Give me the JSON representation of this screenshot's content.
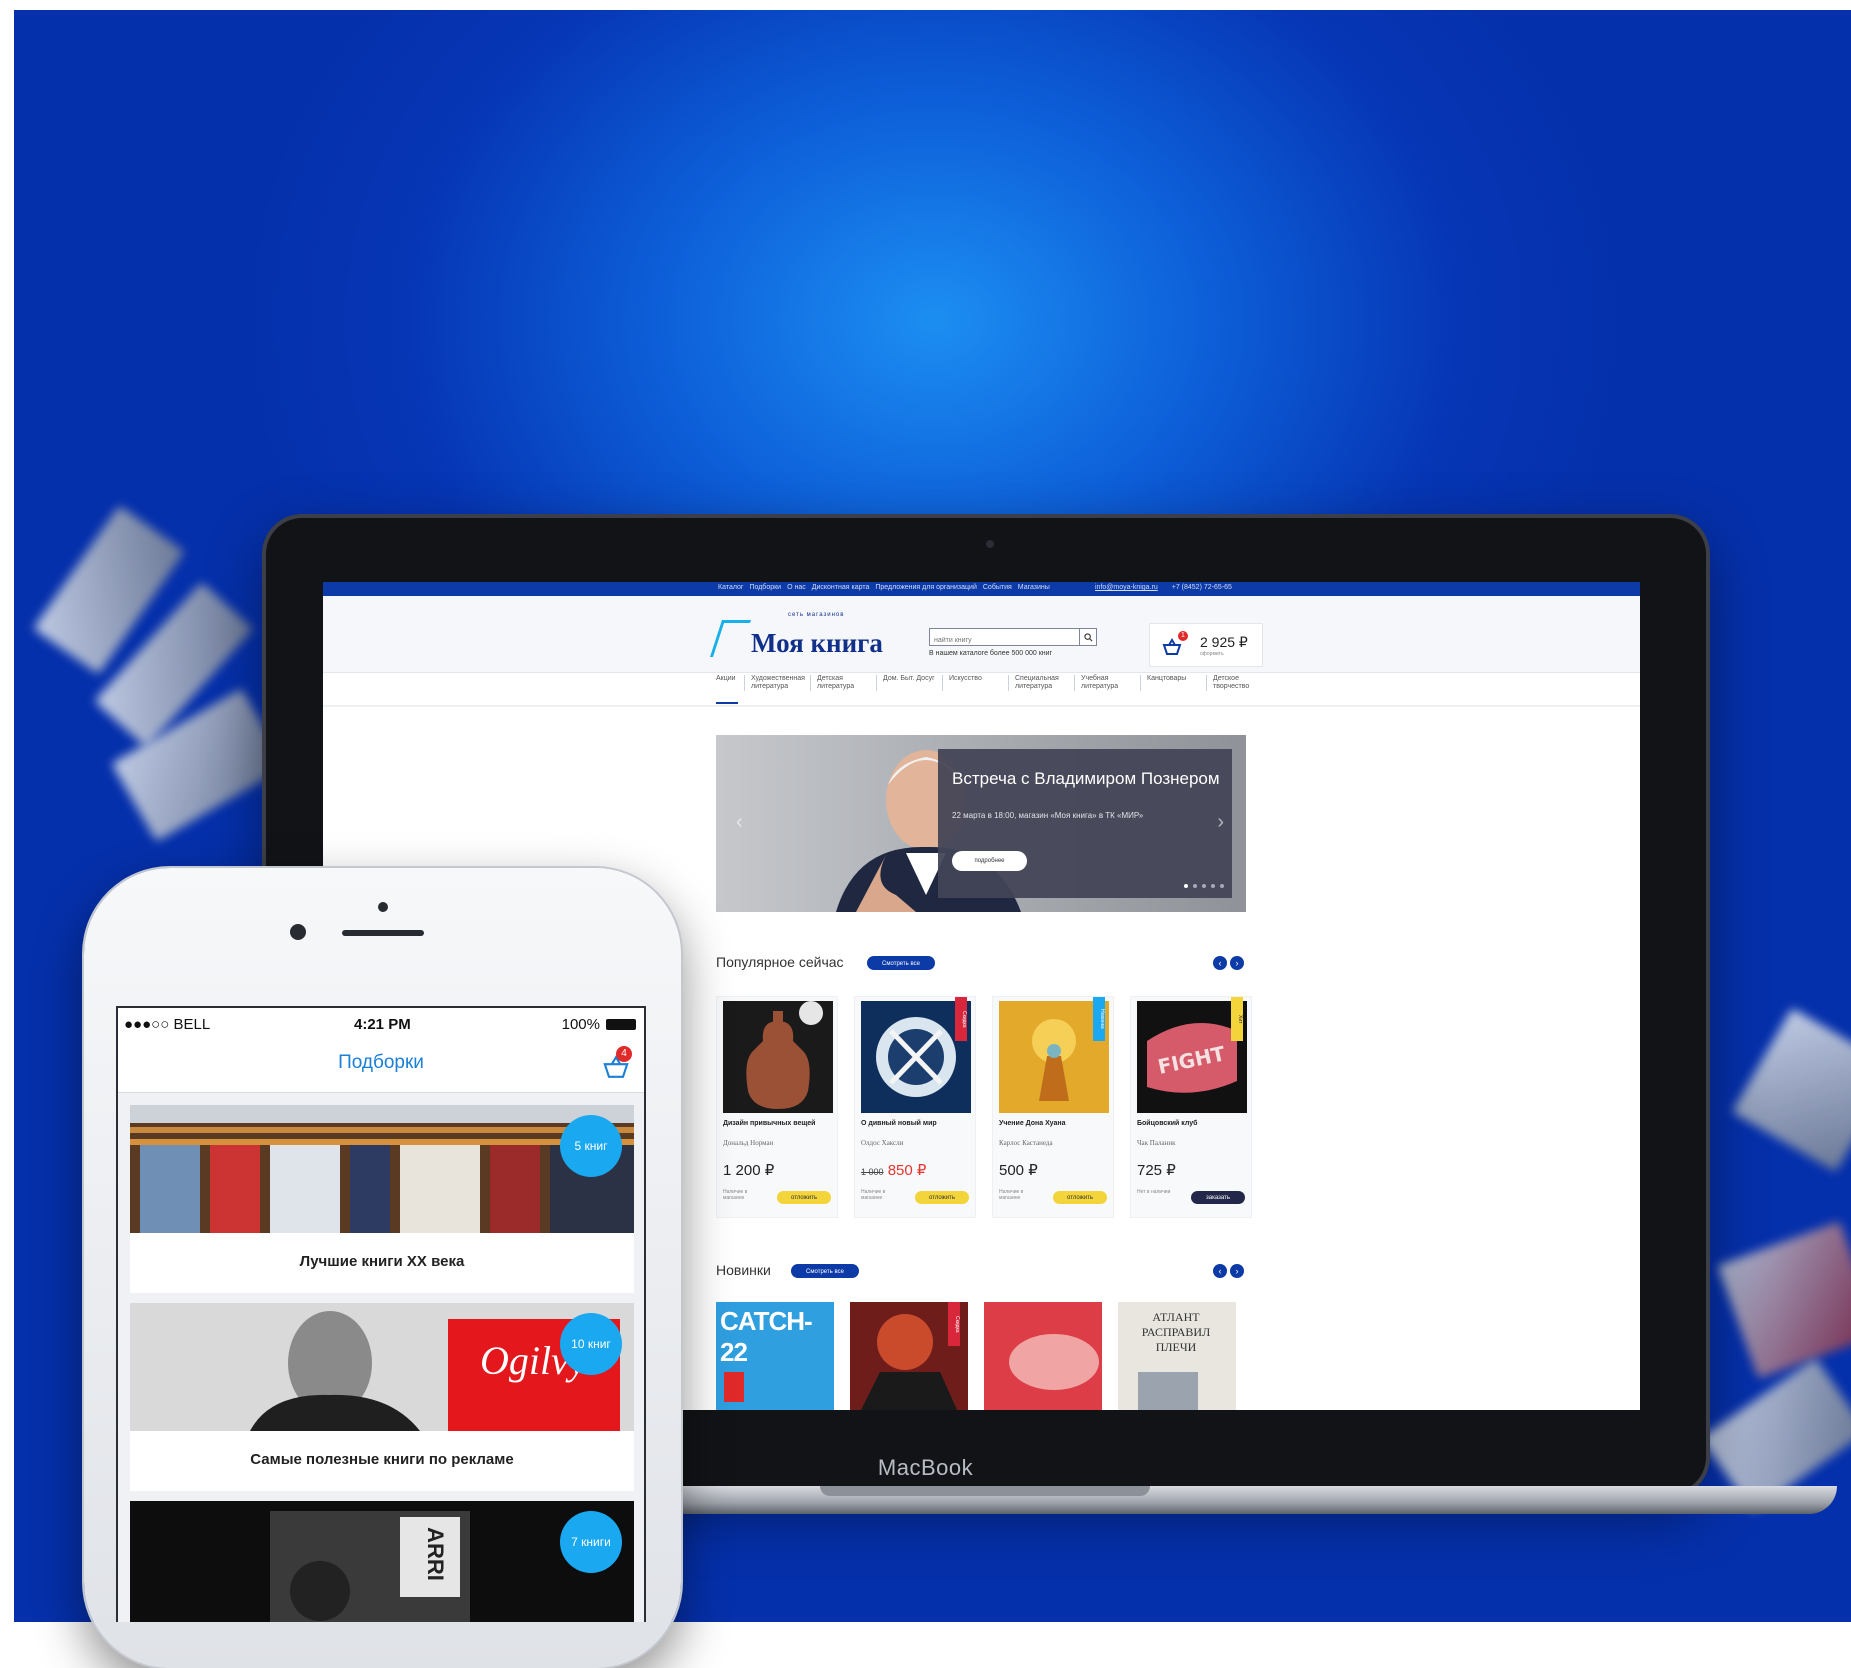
{
  "colors": {
    "brand_blue": "#0c3aa6",
    "accent_cyan": "#1aa9f0",
    "price_red": "#e4352f",
    "button_yellow": "#f3d43a",
    "background_blue": "#0636b5"
  },
  "laptop": {
    "brand": "MacBook"
  },
  "site": {
    "topnav": [
      "Каталог",
      "Подборки",
      "О нас",
      "Дисконтная карта",
      "Предложения для организаций",
      "События",
      "Магазины"
    ],
    "email": "info@moya-kniga.ru",
    "phone": "+7 (8452) 72-65-65",
    "logo_text": "Моя книга",
    "logo_subtitle": "сеть магазинов",
    "search": {
      "placeholder": "найти книгу",
      "note": "В нашем каталоге более 500 000 книг"
    },
    "cart": {
      "price": "2 925 ₽",
      "subtitle": "оформить",
      "badge": "1"
    },
    "categories": [
      "Акции",
      "Художественная литература",
      "Детская литература",
      "Дом. Быт. Досуг",
      "Искусство",
      "Специальная литература",
      "Учебная литература",
      "Канцтовары",
      "Детское творчество"
    ],
    "banner": {
      "title": "Встреча с Владимиром Познером",
      "subtitle": "22 марта в 18:00, магазин «Моя книга» в ТК «МИР»",
      "button": "подробнее",
      "prev": "‹",
      "next": "›"
    },
    "popular": {
      "title": "Популярное сейчас",
      "see_all": "Смотреть все",
      "prev": "‹",
      "next": "›",
      "products": [
        {
          "title": "Дизайн привычных вещей",
          "author": "Дональд Норман",
          "price": "1 200 ₽",
          "old_price": "",
          "stock": "Наличие в магазине",
          "button": "отложить",
          "ribbon": ""
        },
        {
          "title": "О дивный новый мир",
          "author": "Олдос Хаксли",
          "price": "850 ₽",
          "old_price": "1 000",
          "stock": "Наличие в магазине",
          "button": "отложить",
          "ribbon": "Скидка"
        },
        {
          "title": "Учение Дона Хуана",
          "author": "Карлос Кастанеда",
          "price": "500 ₽",
          "old_price": "",
          "stock": "Наличие в магазине",
          "button": "отложить",
          "ribbon": "Новинка"
        },
        {
          "title": "Бойцовский клуб",
          "author": "Чак Паланик",
          "price": "725 ₽",
          "old_price": "",
          "stock": "Нет в наличии",
          "button": "заказать",
          "ribbon": "Хит"
        }
      ]
    },
    "new": {
      "title": "Новинки",
      "see_all": "Смотреть все",
      "prev": "‹",
      "next": "›",
      "covers": [
        {
          "text": "CATCH-22",
          "ribbon": ""
        },
        {
          "text": "",
          "ribbon": "Скидка"
        },
        {
          "text": "",
          "ribbon": ""
        },
        {
          "text": "АТЛАНТ РАСПРАВИЛ ПЛЕЧИ",
          "ribbon": ""
        }
      ]
    }
  },
  "phone": {
    "carrier": "●●●○○ BELL",
    "time": "4:21 PM",
    "battery": "100%",
    "title": "Подборки",
    "cart_badge": "4",
    "collections": [
      {
        "caption": "Лучшие книги XX века",
        "badge": "5 книг"
      },
      {
        "caption": "Самые полезные книги по рекламе",
        "badge": "10 книг",
        "image_text": "Ogilvy"
      },
      {
        "caption": "",
        "badge": "7 книги",
        "image_text": "ARRI"
      }
    ]
  }
}
